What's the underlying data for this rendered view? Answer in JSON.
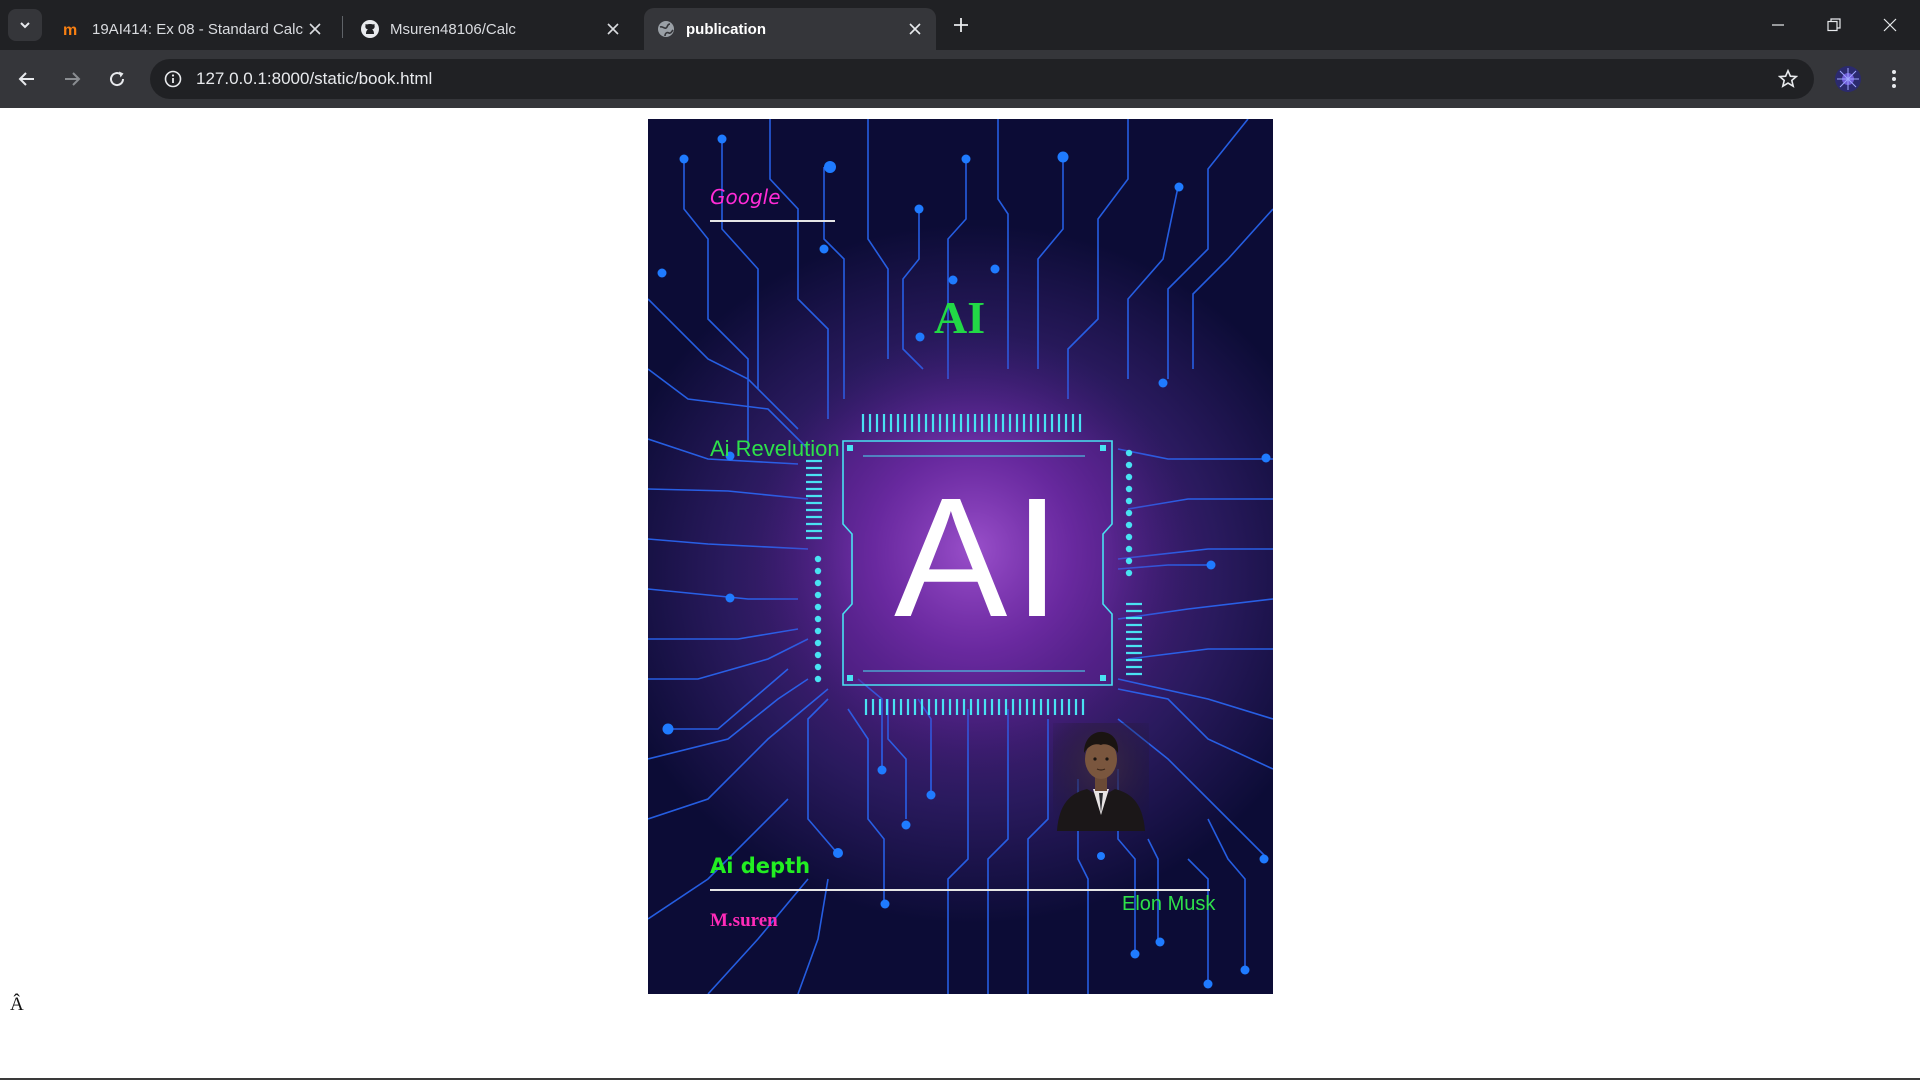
{
  "browser": {
    "tabs": [
      {
        "title": "19AI414: Ex 08 - Standard Calcu",
        "icon": "moodle-icon",
        "active": false
      },
      {
        "title": "Msuren48106/Calc",
        "icon": "github-icon",
        "active": false
      },
      {
        "title": "publication",
        "icon": "globe-icon",
        "active": true
      }
    ],
    "url": "127.0.0.1:8000/static/book.html"
  },
  "cover": {
    "publisher": "Google",
    "title": "AI",
    "subtitle": "Ai Revelution",
    "chip_label": "AI",
    "book_name": "Ai depth",
    "author": "M.suren",
    "credit": "Elon Musk"
  },
  "page": {
    "stray_char": "Â"
  },
  "colors": {
    "accent_green": "#22d846",
    "accent_pink": "#ff2bd6",
    "circuit_blue": "#1e6cff",
    "chip_cyan": "#38e4f0"
  }
}
